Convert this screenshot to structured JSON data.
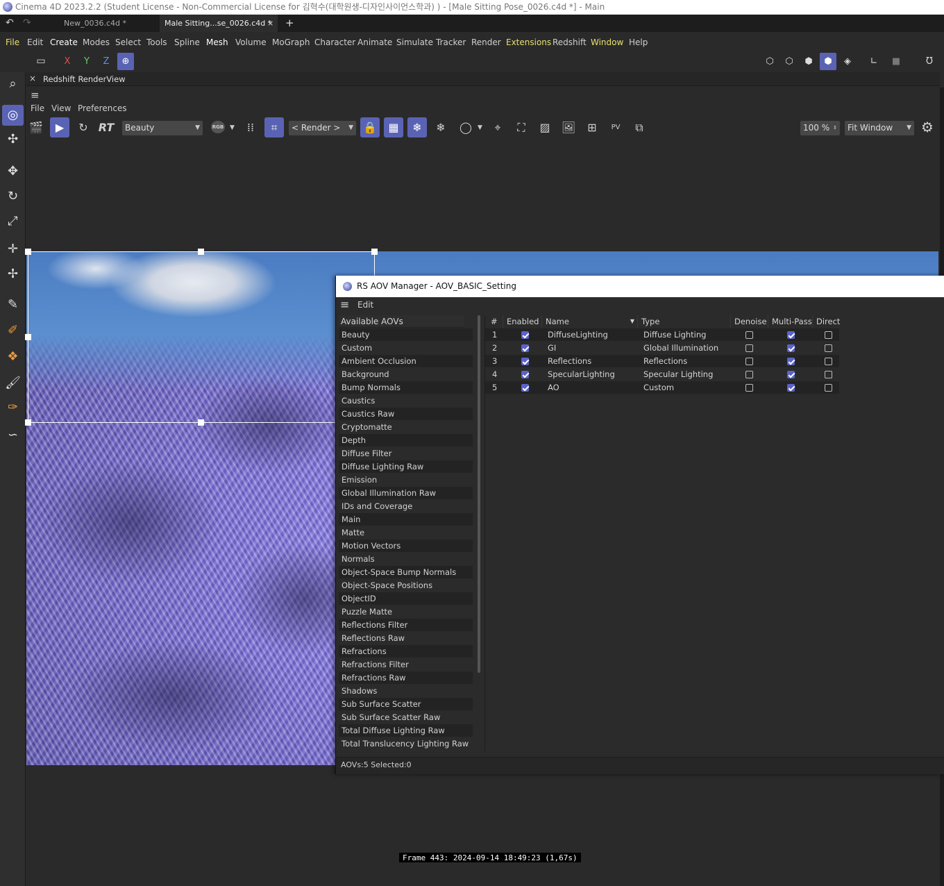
{
  "window": {
    "title": "Cinema 4D 2023.2.2 (Student License - Non-Commercial License for 김혁수(대학원생-디자인사이언스학과) ) - [Male Sitting Pose_0026.c4d *] - Main"
  },
  "tabs": [
    {
      "label": "New_0036.c4d *"
    },
    {
      "label": "Male Sitting...se_0026.c4d *"
    }
  ],
  "tab_close": "×",
  "tab_add": "+",
  "menu": [
    "File",
    "Edit",
    "Create",
    "Modes",
    "Select",
    "Tools",
    "Spline",
    "Mesh",
    "Volume",
    "MoGraph",
    "Character",
    "Animate",
    "Simulate",
    "Tracker",
    "Render",
    "Extensions",
    "Redshift",
    "Window",
    "Help"
  ],
  "axes": {
    "x": "X",
    "y": "Y",
    "z": "Z"
  },
  "renderview": {
    "title": "Redshift RenderView",
    "close": "×",
    "menu": [
      "File",
      "View",
      "Preferences"
    ],
    "rt_label": "RT",
    "aov_select": "Beauty",
    "rgb_label": "RGB",
    "render_select": "< Render >",
    "zoom": "100 %",
    "fit": "Fit Window",
    "frame_info": "Frame  443:  2024-09-14  18:49:23  (1,67s)"
  },
  "aov_manager": {
    "title": "RS AOV Manager - AOV_BASIC_Setting",
    "menu_edit": "Edit",
    "available_header": "Available AOVs",
    "available": [
      "Beauty",
      "Custom",
      "Ambient Occlusion",
      "Background",
      "Bump Normals",
      "Caustics",
      "Caustics Raw",
      "Cryptomatte",
      "Depth",
      "Diffuse Filter",
      "Diffuse Lighting Raw",
      "Emission",
      "Global Illumination Raw",
      "IDs and Coverage",
      "Main",
      "Matte",
      "Motion Vectors",
      "Normals",
      "Object-Space Bump Normals",
      "Object-Space Positions",
      "ObjectID",
      "Puzzle Matte",
      "Reflections Filter",
      "Reflections Raw",
      "Refractions",
      "Refractions Filter",
      "Refractions Raw",
      "Shadows",
      "Sub Surface Scatter",
      "Sub Surface Scatter Raw",
      "Total Diffuse Lighting Raw",
      "Total Translucency Lighting Raw"
    ],
    "columns": [
      "#",
      "Enabled",
      "Name",
      "Type",
      "Denoise",
      "Multi-Pass",
      "Direct"
    ],
    "sort_indicator": "▼",
    "rows": [
      {
        "num": "1",
        "enabled": true,
        "name": "DiffuseLighting",
        "type": "Diffuse Lighting",
        "denoise": false,
        "multipass": true,
        "direct": false
      },
      {
        "num": "2",
        "enabled": true,
        "name": "GI",
        "type": "Global Illumination",
        "denoise": false,
        "multipass": true,
        "direct": false
      },
      {
        "num": "3",
        "enabled": true,
        "name": "Reflections",
        "type": "Reflections",
        "denoise": false,
        "multipass": true,
        "direct": false
      },
      {
        "num": "4",
        "enabled": true,
        "name": "SpecularLighting",
        "type": "Specular Lighting",
        "denoise": false,
        "multipass": true,
        "direct": false
      },
      {
        "num": "5",
        "enabled": true,
        "name": "AO",
        "type": "Custom",
        "denoise": false,
        "multipass": true,
        "direct": false
      }
    ],
    "status": "AOVs:5 Selected:0"
  },
  "colors": {
    "accent": "#5a63b3",
    "menu_highlight": "#e8e070",
    "axis_x": "#e05050",
    "axis_y": "#60d060",
    "axis_z": "#5b8fe8"
  }
}
